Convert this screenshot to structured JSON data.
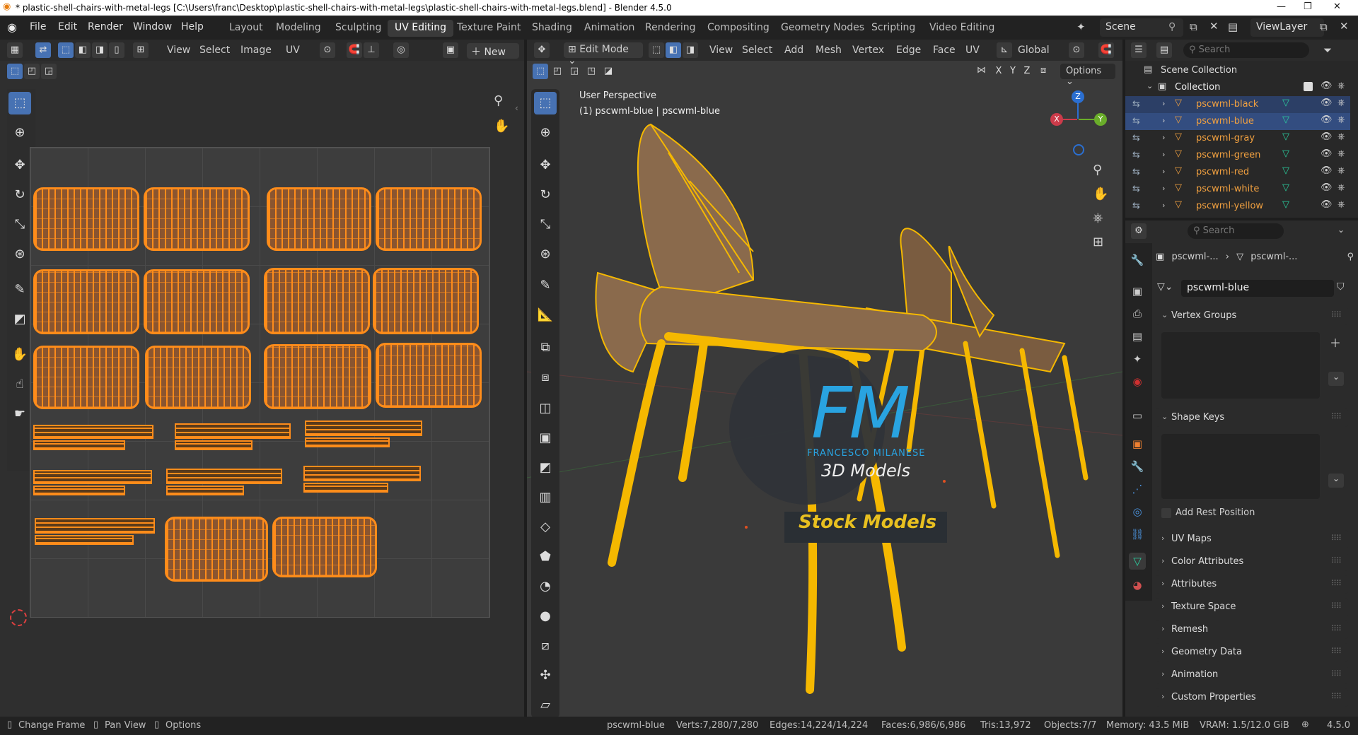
{
  "window": {
    "title": "* plastic-shell-chairs-with-metal-legs [C:\\Users\\franc\\Desktop\\plastic-shell-chairs-with-metal-legs\\plastic-shell-chairs-with-metal-legs.blend] - Blender 4.5.0"
  },
  "menu": [
    "File",
    "Edit",
    "Render",
    "Window",
    "Help"
  ],
  "workspaces": [
    "Layout",
    "Modeling",
    "Sculpting",
    "UV Editing",
    "Texture Paint",
    "Shading",
    "Animation",
    "Rendering",
    "Compositing",
    "Geometry Nodes",
    "Scripting",
    "Video Editing"
  ],
  "active_workspace": "UV Editing",
  "scene": "Scene",
  "view_layer": "ViewLayer",
  "uv_editor": {
    "menus": [
      "View",
      "Select",
      "Image",
      "UV"
    ],
    "new_label": "New"
  },
  "viewport": {
    "mode": "Edit Mode",
    "menus": [
      "View",
      "Select",
      "Add",
      "Mesh",
      "Vertex",
      "Edge",
      "Face",
      "UV"
    ],
    "orientation": "Global",
    "options": "Options",
    "overlay_title": "User Perspective",
    "overlay_object": "(1) pscwml-blue | pscwml-blue",
    "axes": {
      "x": "X",
      "y": "Y",
      "z": "Z"
    },
    "watermark": {
      "big": "FM",
      "name": "FRANCESCO MILANESE",
      "sub": "3D Models",
      "stock": "Stock Models"
    }
  },
  "outliner": {
    "search_placeholder": "Search",
    "scene_collection": "Scene Collection",
    "collection": "Collection",
    "objects": [
      "pscwml-black",
      "pscwml-blue",
      "pscwml-gray",
      "pscwml-green",
      "pscwml-red",
      "pscwml-white",
      "pscwml-yellow"
    ],
    "selected": "pscwml-blue"
  },
  "properties": {
    "search_placeholder": "Search",
    "breadcrumb_obj": "pscwml-...",
    "breadcrumb_mesh": "pscwml-...",
    "mesh_name": "pscwml-blue",
    "vertex_groups": "Vertex Groups",
    "shape_keys": "Shape Keys",
    "add_rest": "Add Rest Position",
    "panels": [
      "UV Maps",
      "Color Attributes",
      "Attributes",
      "Texture Space",
      "Remesh",
      "Geometry Data",
      "Animation",
      "Custom Properties"
    ]
  },
  "status": {
    "left": [
      "Change Frame",
      "Pan View",
      "Options"
    ],
    "object": "pscwml-blue",
    "verts": "Verts:7,280/7,280",
    "edges": "Edges:14,224/14,224",
    "faces": "Faces:6,986/6,986",
    "tris": "Tris:13,972",
    "objects": "Objects:7/7",
    "memory": "Memory: 43.5 MiB",
    "vram": "VRAM: 1.5/12.0 GiB",
    "version": "4.5.0"
  },
  "colors": {
    "accent": "#4772b3",
    "selection": "#ff8c1a",
    "wire": "#f5b800"
  }
}
